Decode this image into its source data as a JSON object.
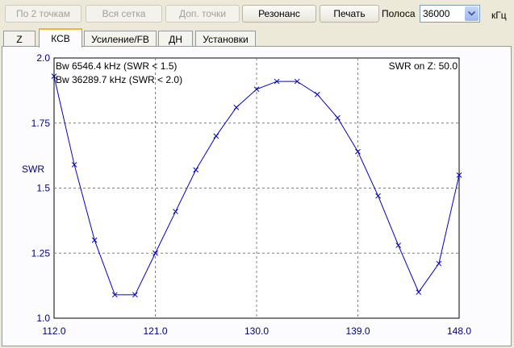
{
  "toolbar": {
    "buttons": [
      {
        "label": "По 2 точкам",
        "enabled": false
      },
      {
        "label": "Вся сетка",
        "enabled": false
      },
      {
        "label": "Доп. точки",
        "enabled": false
      },
      {
        "label": "Резонанс",
        "enabled": true
      },
      {
        "label": "Печать",
        "enabled": true
      }
    ],
    "band_label": "Полоса",
    "band_value": "36000",
    "band_unit": "кГц"
  },
  "tabs": [
    {
      "label": "Z",
      "selected": false
    },
    {
      "label": "КСВ",
      "selected": true
    },
    {
      "label": "Усиление/FB",
      "selected": false
    },
    {
      "label": "ДН",
      "selected": false
    },
    {
      "label": "Установки",
      "selected": false
    }
  ],
  "colors": {
    "line": "#0000cc",
    "axis_text": "#000080",
    "grid": "#808080"
  },
  "chart_data": {
    "type": "line",
    "ylabel": "SWR",
    "xlabel": "",
    "xlim": [
      112.0,
      148.0
    ],
    "ylim": [
      1.0,
      2.0
    ],
    "xticks": [
      "112.0",
      "121.0",
      "130.0",
      "139.0",
      "148.0"
    ],
    "yticks": [
      "1.0",
      "1.25",
      "1.5",
      "1.75",
      "2.0"
    ],
    "grid": true,
    "annotations": [
      "Bw 6546.4 kHz (SWR < 1.5)",
      "Bw 36289.7 kHz (SWR < 2.0)",
      "SWR on Z: 50.0"
    ],
    "series": [
      {
        "x": [
          112.0,
          113.8,
          115.6,
          117.4,
          119.2,
          121.0,
          122.8,
          124.6,
          126.4,
          128.2,
          130.0,
          131.8,
          133.6,
          135.4,
          137.2,
          139.0,
          140.8,
          142.6,
          144.4,
          146.2,
          148.0
        ],
        "y": [
          1.93,
          1.59,
          1.3,
          1.09,
          1.09,
          1.25,
          1.41,
          1.57,
          1.7,
          1.81,
          1.88,
          1.91,
          1.91,
          1.86,
          1.77,
          1.64,
          1.47,
          1.28,
          1.1,
          1.21,
          1.55
        ]
      }
    ]
  }
}
